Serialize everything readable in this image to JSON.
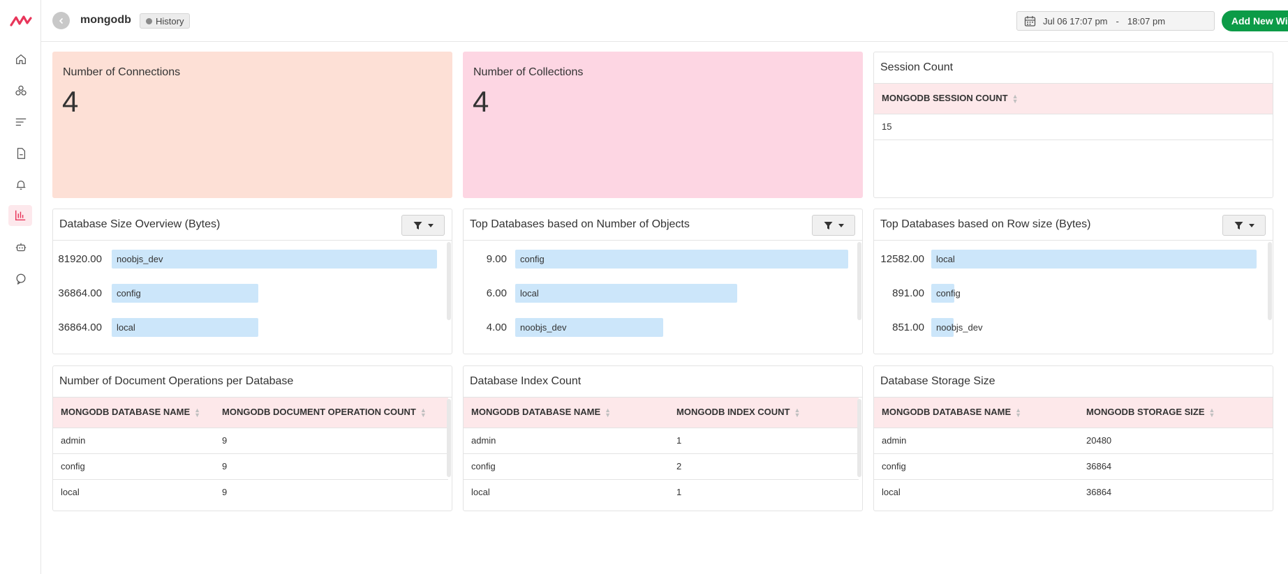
{
  "sidebar": {
    "items": [
      {
        "icon": "home-icon"
      },
      {
        "icon": "services-icon"
      },
      {
        "icon": "filter-list-icon"
      },
      {
        "icon": "document-icon"
      },
      {
        "icon": "bell-icon"
      },
      {
        "icon": "bar-chart-icon",
        "active": true
      },
      {
        "icon": "robot-icon"
      },
      {
        "icon": "support-icon"
      }
    ]
  },
  "header": {
    "title": "mongodb",
    "history_label": "History",
    "date_start": "Jul 06 17:07 pm",
    "date_sep": "-",
    "date_end": "18:07 pm",
    "add_widget_label": "Add New Widget"
  },
  "widgets": {
    "connections": {
      "title": "Number of Connections",
      "value": "4"
    },
    "collections": {
      "title": "Number of Collections",
      "value": "4"
    },
    "session": {
      "title": "Session Count",
      "column": "MONGODB SESSION COUNT",
      "rows": [
        "15"
      ]
    },
    "db_size": {
      "title": "Database Size Overview (Bytes)",
      "bars": [
        {
          "value": "81920.00",
          "label": "noobjs_dev",
          "num": 81920
        },
        {
          "value": "36864.00",
          "label": "config",
          "num": 36864
        },
        {
          "value": "36864.00",
          "label": "local",
          "num": 36864
        }
      ]
    },
    "top_objects": {
      "title": "Top Databases based on Number of Objects",
      "bars": [
        {
          "value": "9.00",
          "label": "config",
          "num": 9
        },
        {
          "value": "6.00",
          "label": "local",
          "num": 6
        },
        {
          "value": "4.00",
          "label": "noobjs_dev",
          "num": 4
        }
      ]
    },
    "top_rowsize": {
      "title": "Top Databases based on Row size (Bytes)",
      "bars": [
        {
          "value": "12582.00",
          "label": "local",
          "num": 12582
        },
        {
          "value": "891.00",
          "label": "config",
          "num": 891
        },
        {
          "value": "851.00",
          "label": "noobjs_dev",
          "num": 851
        }
      ]
    },
    "doc_ops": {
      "title": "Number of Document Operations per Database",
      "columns": [
        "MONGODB DATABASE NAME",
        "MONGODB DOCUMENT OPERATION COUNT"
      ],
      "rows": [
        [
          "admin",
          "9"
        ],
        [
          "config",
          "9"
        ],
        [
          "local",
          "9"
        ]
      ]
    },
    "index_count": {
      "title": "Database Index Count",
      "columns": [
        "MONGODB DATABASE NAME",
        "MONGODB INDEX COUNT"
      ],
      "rows": [
        [
          "admin",
          "1"
        ],
        [
          "config",
          "2"
        ],
        [
          "local",
          "1"
        ]
      ]
    },
    "storage": {
      "title": "Database Storage Size",
      "columns": [
        "MONGODB DATABASE NAME",
        "MONGODB STORAGE SIZE"
      ],
      "rows": [
        [
          "admin",
          "20480"
        ],
        [
          "config",
          "36864"
        ],
        [
          "local",
          "36864"
        ]
      ]
    }
  },
  "colors": {
    "accent": "#e8355a",
    "connections_bg": "#fde0d6",
    "collections_bg": "#fdd6e3",
    "bar": "#cce6fa",
    "primary_button": "#0c9b47"
  }
}
